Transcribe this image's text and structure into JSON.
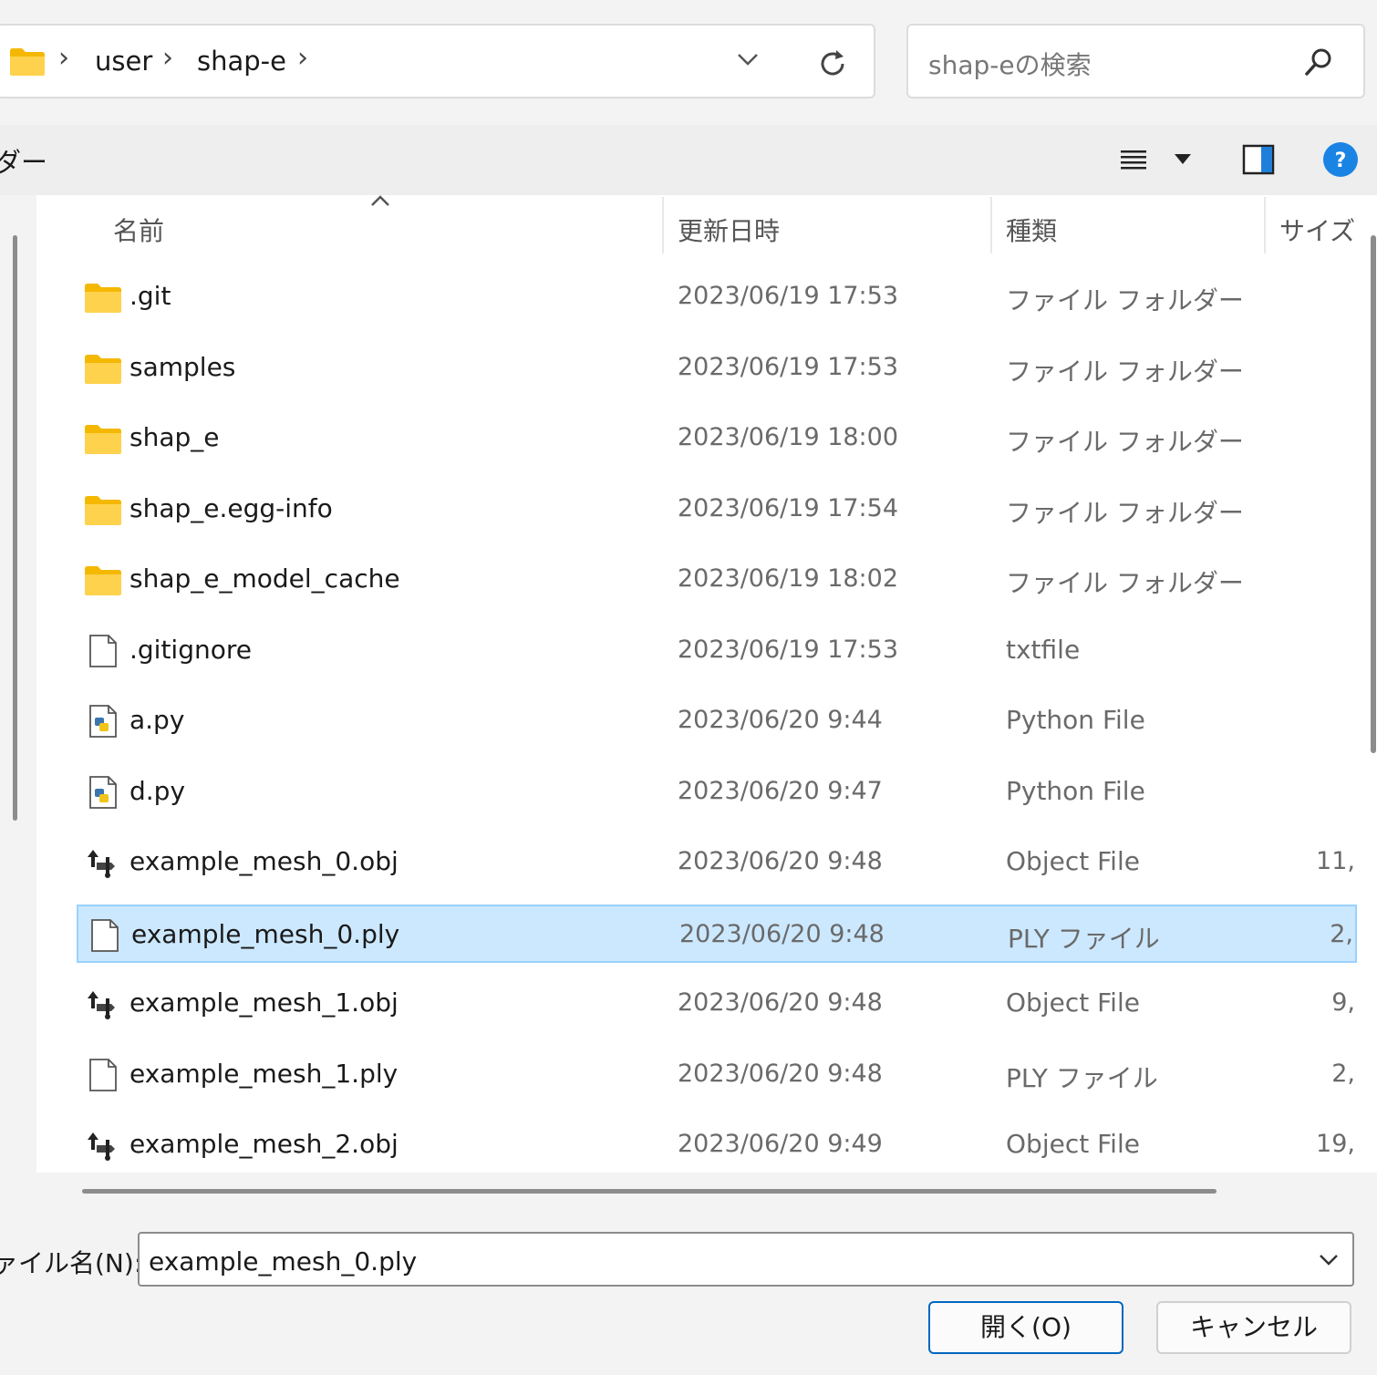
{
  "address_bar": {
    "folder_icon": "folder-icon",
    "path": [
      "user",
      "shap-e"
    ],
    "separator": "›"
  },
  "search": {
    "placeholder": "shap-eの検索",
    "icon": "search-icon"
  },
  "toolbar": {
    "left_label": "ダー",
    "icons": [
      "view-menu-icon",
      "chevron-down-icon",
      "preview-pane-icon",
      "help-icon"
    ]
  },
  "columns": {
    "name": "名前",
    "date": "更新日時",
    "type": "種類",
    "size": "サイズ"
  },
  "files": [
    {
      "name": ".git",
      "date": "2023/06/19 17:53",
      "type": "ファイル フォルダー",
      "size": "",
      "icon": "folder-icon",
      "selected": false
    },
    {
      "name": "samples",
      "date": "2023/06/19 17:53",
      "type": "ファイル フォルダー",
      "size": "",
      "icon": "folder-icon",
      "selected": false
    },
    {
      "name": "shap_e",
      "date": "2023/06/19 18:00",
      "type": "ファイル フォルダー",
      "size": "",
      "icon": "folder-icon",
      "selected": false
    },
    {
      "name": "shap_e.egg-info",
      "date": "2023/06/19 17:54",
      "type": "ファイル フォルダー",
      "size": "",
      "icon": "folder-icon",
      "selected": false
    },
    {
      "name": "shap_e_model_cache",
      "date": "2023/06/19 18:02",
      "type": "ファイル フォルダー",
      "size": "",
      "icon": "folder-icon",
      "selected": false
    },
    {
      "name": ".gitignore",
      "date": "2023/06/19 17:53",
      "type": "txtfile",
      "size": "",
      "icon": "file-icon",
      "selected": false
    },
    {
      "name": "a.py",
      "date": "2023/06/20 9:44",
      "type": "Python File",
      "size": "",
      "icon": "python-file-icon",
      "selected": false
    },
    {
      "name": "d.py",
      "date": "2023/06/20 9:47",
      "type": "Python File",
      "size": "",
      "icon": "python-file-icon",
      "selected": false
    },
    {
      "name": "example_mesh_0.obj",
      "date": "2023/06/20 9:48",
      "type": "Object File",
      "size": "11,",
      "icon": "object-file-icon",
      "selected": false
    },
    {
      "name": "example_mesh_0.ply",
      "date": "2023/06/20 9:48",
      "type": "PLY ファイル",
      "size": "2,",
      "icon": "file-icon",
      "selected": true
    },
    {
      "name": "example_mesh_1.obj",
      "date": "2023/06/20 9:48",
      "type": "Object File",
      "size": "9,",
      "icon": "object-file-icon",
      "selected": false
    },
    {
      "name": "example_mesh_1.ply",
      "date": "2023/06/20 9:48",
      "type": "PLY ファイル",
      "size": "2,",
      "icon": "file-icon",
      "selected": false
    },
    {
      "name": "example_mesh_2.obj",
      "date": "2023/06/20 9:49",
      "type": "Object File",
      "size": "19,",
      "icon": "object-file-icon",
      "selected": false
    }
  ],
  "filename": {
    "label": "ァイル名(N):",
    "value": "example_mesh_0.ply"
  },
  "buttons": {
    "open": "開く(O)",
    "cancel": "キャンセル"
  },
  "colors": {
    "selection": "#cce8ff",
    "selection_border": "#99d1ff",
    "accent": "#0067c0",
    "folder": "#ffcc33"
  }
}
